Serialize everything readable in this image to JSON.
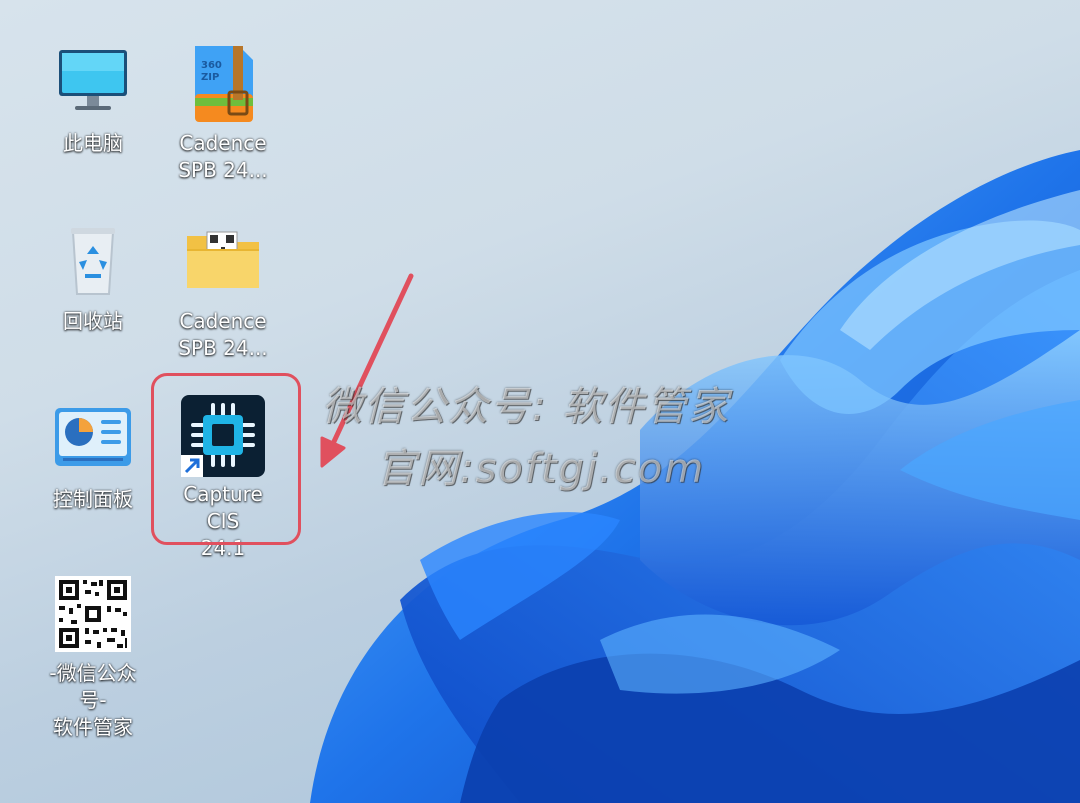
{
  "desktop": {
    "icons": [
      {
        "label": "此电脑",
        "icon": "computer-icon"
      },
      {
        "label": "Cadence\nSPB 24...",
        "icon": "zip-archive-icon",
        "badge": "360\nZIP"
      },
      {
        "label": "回收站",
        "icon": "recycle-bin-icon"
      },
      {
        "label": "Cadence\nSPB 24...",
        "icon": "folder-icon"
      },
      {
        "label": "控制面板",
        "icon": "control-panel-icon"
      },
      {
        "label": "Capture CIS\n24.1",
        "icon": "chip-shortcut-icon"
      },
      {
        "label": "-微信公众号-\n软件管家",
        "icon": "qr-code-icon"
      }
    ]
  },
  "watermark": {
    "line1": "微信公众号: 软件管家",
    "line2": "官网:softgj.com"
  },
  "colors": {
    "highlight": "#e0505e",
    "wallpaper_blue": "#1a6fe6",
    "chip_bg": "#0b2033",
    "chip_accent": "#1fb4e6"
  }
}
